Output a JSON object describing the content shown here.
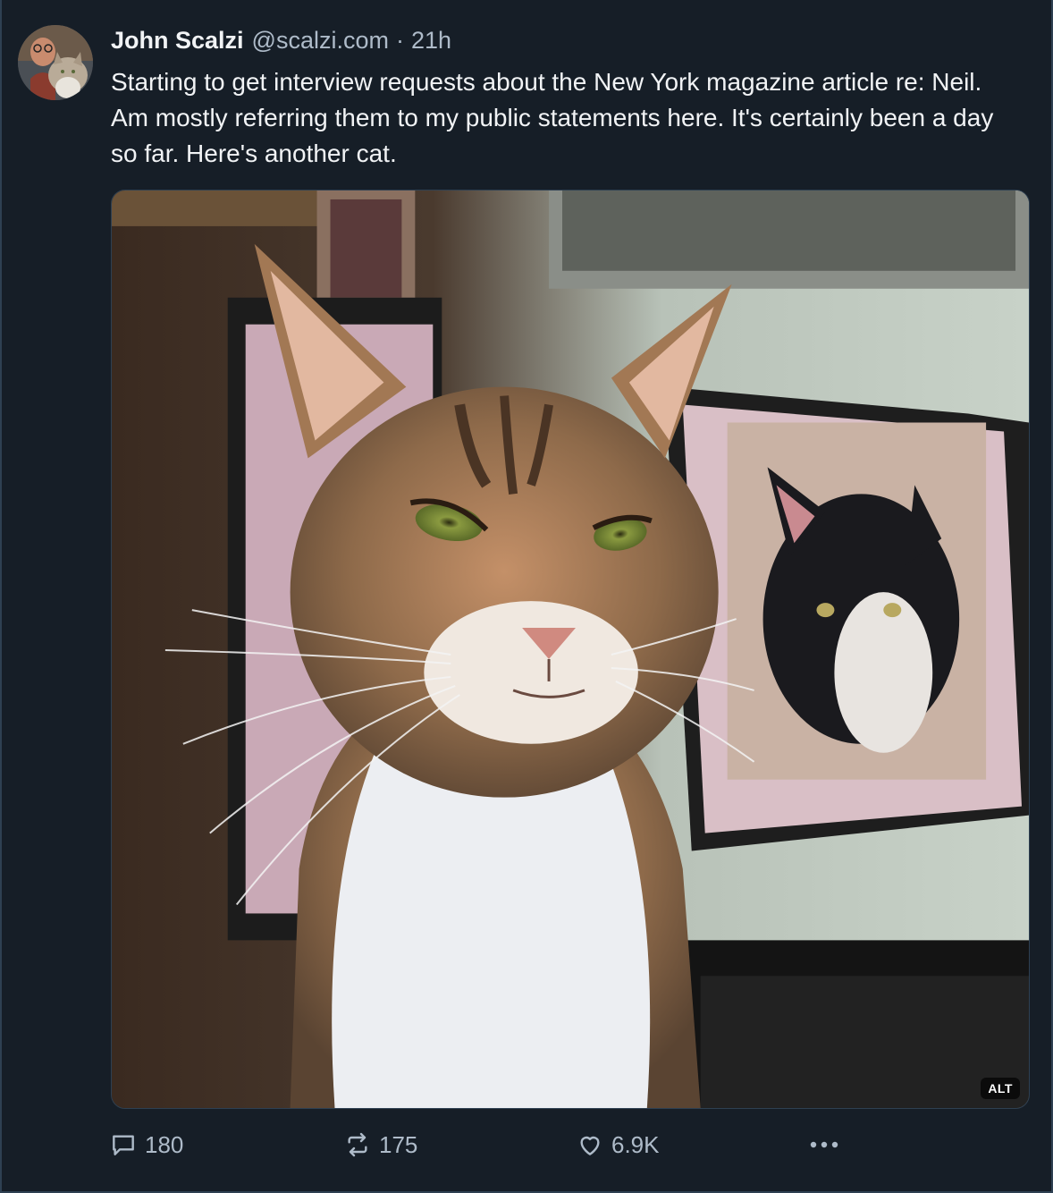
{
  "post": {
    "author": {
      "name": "John Scalzi",
      "handle": "@scalzi.com"
    },
    "separator": "·",
    "timestamp": "21h",
    "text": "Starting to get interview requests about the New York magazine article re: Neil. Am mostly referring them to my public statements here. It's certainly been a day so far. Here's another cat.",
    "media": {
      "alt_badge": "ALT"
    },
    "actions": {
      "reply_icon": "speech-bubble-icon",
      "reply_count": "180",
      "repost_icon": "repost-arrows-icon",
      "repost_count": "175",
      "like_icon": "heart-icon",
      "like_count": "6.9K",
      "more_icon": "more-dots-icon"
    }
  },
  "colors": {
    "background": "#161e27",
    "border": "#2e4052",
    "text_primary": "#f1f3f5",
    "text_secondary": "#aebbc9"
  }
}
